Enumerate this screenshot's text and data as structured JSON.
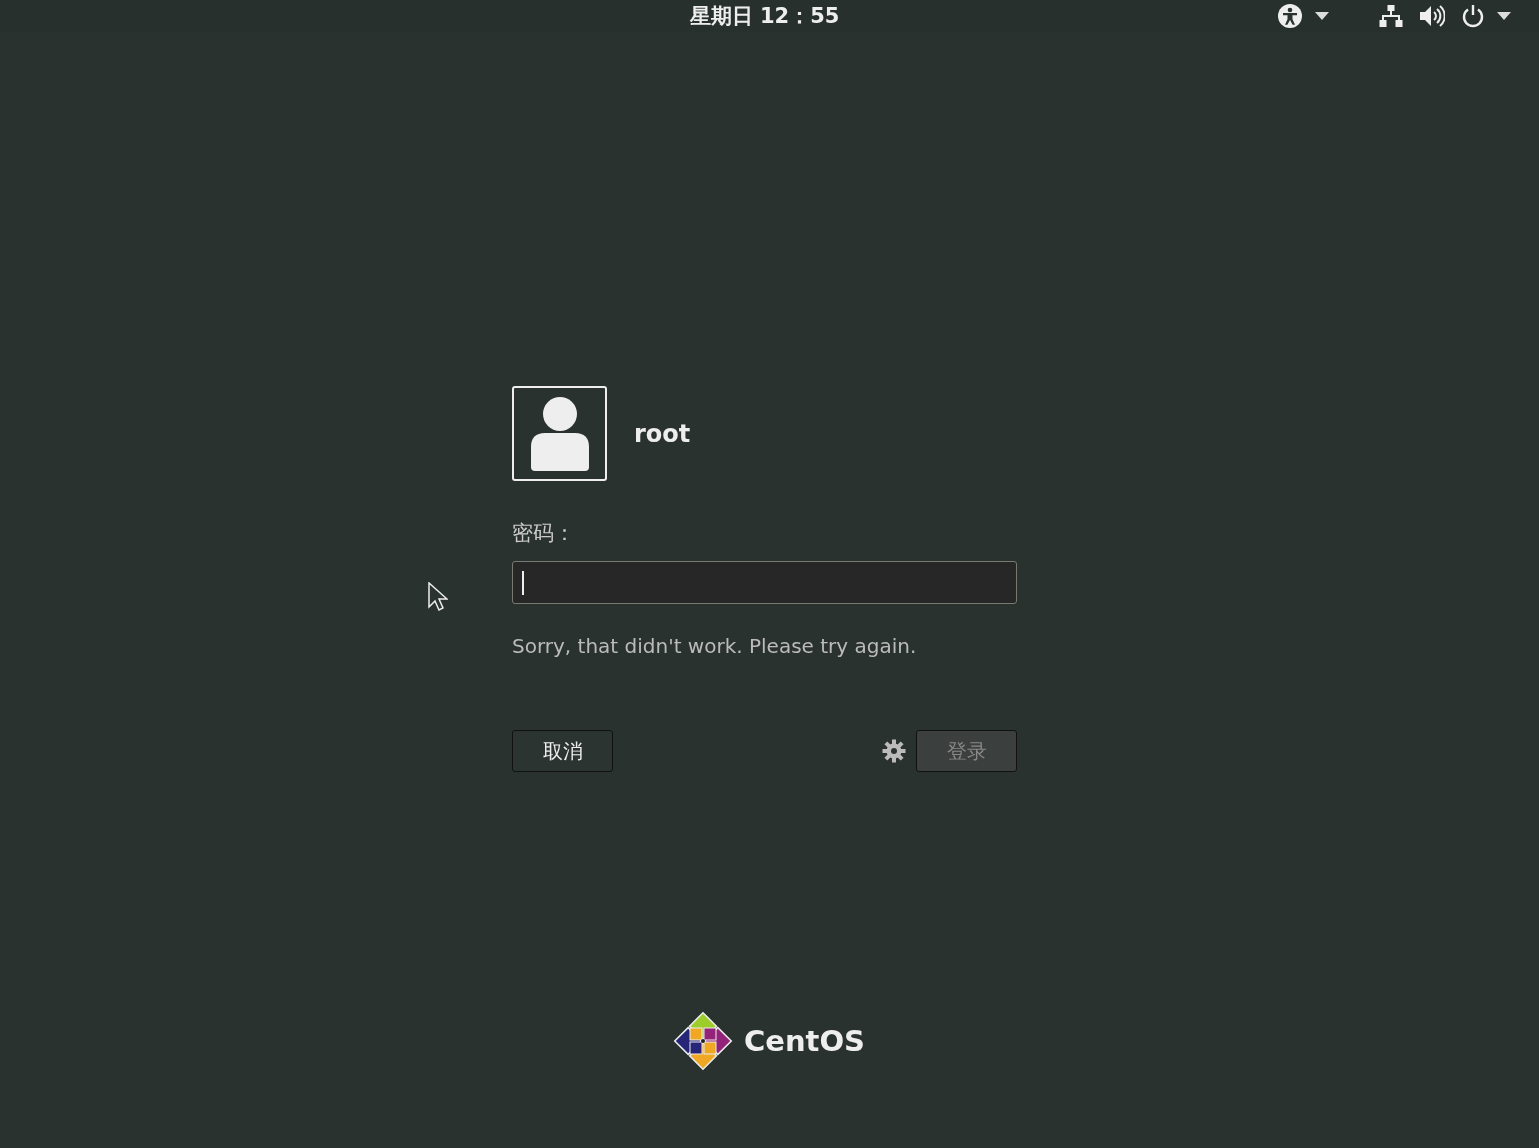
{
  "top_bar": {
    "clock": "星期日 12：55"
  },
  "user": {
    "name": "root"
  },
  "password": {
    "label": "密码："
  },
  "error_message": "Sorry, that didn't work. Please try again.",
  "buttons": [
    {
      "kind": "cancel",
      "label": "取消",
      "disabled": false
    },
    {
      "kind": "login",
      "label": "登录",
      "disabled": true
    }
  ],
  "logo": {
    "text": "CentOS"
  }
}
